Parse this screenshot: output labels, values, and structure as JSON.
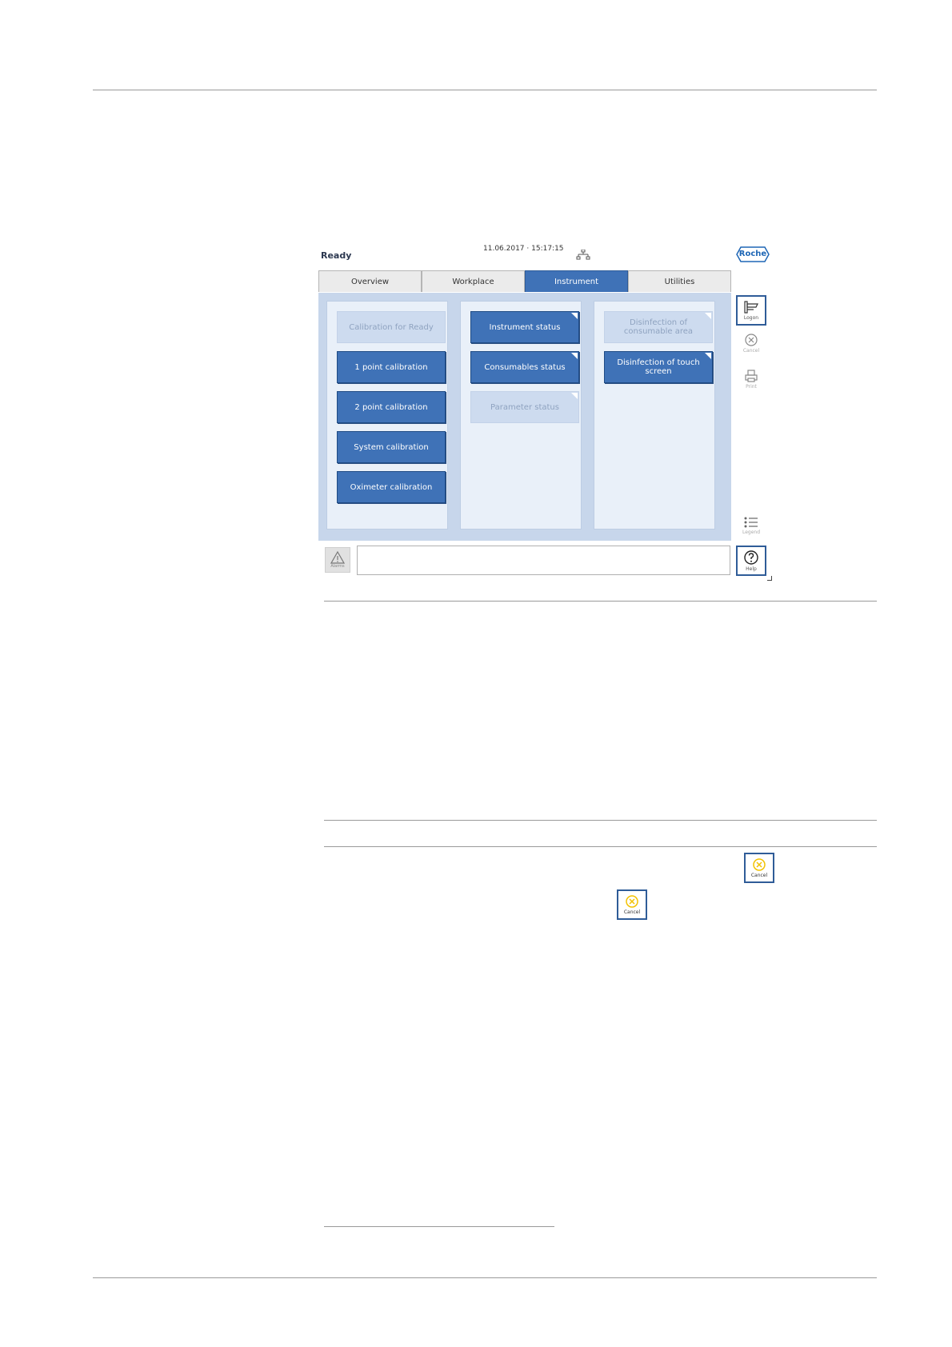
{
  "status": {
    "state": "Ready",
    "datetime": "11.06.2017 · 15:17:15"
  },
  "brand": {
    "logo_text": "Roche",
    "logo_color": "#1e66b5"
  },
  "tabs": [
    {
      "label": "Overview",
      "active": false
    },
    {
      "label": "Workplace",
      "active": false
    },
    {
      "label": "Instrument",
      "active": true
    },
    {
      "label": "Utilities",
      "active": false
    }
  ],
  "columns": [
    {
      "buttons": [
        {
          "label": "Calibration for Ready",
          "enabled": false
        },
        {
          "label": "1 point calibration",
          "enabled": true
        },
        {
          "label": "2 point calibration",
          "enabled": true
        },
        {
          "label": "System calibration",
          "enabled": true
        },
        {
          "label": "Oximeter calibration",
          "enabled": true
        }
      ]
    },
    {
      "buttons": [
        {
          "label": "Instrument status",
          "enabled": true
        },
        {
          "label": "Consumables status",
          "enabled": true
        },
        {
          "label": "Parameter status",
          "enabled": false
        }
      ]
    },
    {
      "buttons": [
        {
          "label": "Disinfection of consumable area",
          "enabled": false
        },
        {
          "label": "Disinfection of touch screen",
          "enabled": true
        }
      ]
    }
  ],
  "sidebar": {
    "logon": {
      "label": "Logon",
      "icon": "logon-icon"
    },
    "cancel": {
      "label": "Cancel",
      "icon": "cancel-icon"
    },
    "print": {
      "label": "Print",
      "icon": "print-icon"
    },
    "legend": {
      "label": "Legend",
      "icon": "legend-icon"
    },
    "help": {
      "label": "Help",
      "icon": "help-icon"
    }
  },
  "alarms": {
    "label": "Alarms",
    "icon": "warning-icon"
  },
  "inline_cancel": {
    "label": "Cancel",
    "icon": "cancel-icon",
    "accent": "#f2c200"
  },
  "colors": {
    "accent": "#3f72b7",
    "panel": "#c7d6eb",
    "disabled": "#cddbef"
  }
}
